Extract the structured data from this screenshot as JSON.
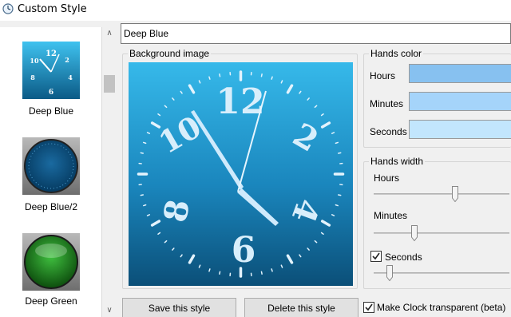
{
  "window": {
    "title": "Custom Style"
  },
  "styles_list": {
    "items": [
      {
        "label": "Deep Blue"
      },
      {
        "label": "Deep Blue/2"
      },
      {
        "label": "Deep Green"
      }
    ]
  },
  "style_name": {
    "value": "Deep Blue"
  },
  "background": {
    "label": "Background image"
  },
  "hands_color": {
    "label": "Hands color",
    "rows": [
      {
        "label": "Hours",
        "color": "#87c1f0"
      },
      {
        "label": "Minutes",
        "color": "#a5d4fa"
      },
      {
        "label": "Seconds",
        "color": "#c2e6fd"
      }
    ]
  },
  "hands_width": {
    "label": "Hands width",
    "hours": {
      "label": "Hours",
      "value": 0.6
    },
    "minutes": {
      "label": "Minutes",
      "value": 0.3
    },
    "seconds": {
      "label": "Seconds",
      "checked": true,
      "value": 0.12
    }
  },
  "buttons": {
    "save": "Save this style",
    "delete": "Delete this style"
  },
  "transparent": {
    "label": "Make Clock transparent (beta)",
    "checked": true
  },
  "clock": {
    "numerals": [
      "12",
      "2",
      "4",
      "6",
      "8",
      "10"
    ]
  },
  "colors": {
    "clock_top": "#36b9ea",
    "clock_bottom": "#0b4f78",
    "hand": "#cfeafc",
    "green": "#1f7a1f"
  }
}
